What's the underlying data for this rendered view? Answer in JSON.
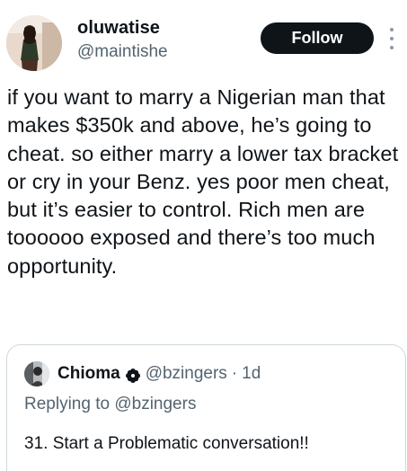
{
  "tweet": {
    "display_name": "oluwatise",
    "handle": "@maintishe",
    "follow_label": "Follow",
    "text": "if you want to marry a Nigerian man that makes $350k and above, he’s going to cheat. so either marry a lower tax bracket or cry in your Benz. yes poor men cheat, but it’s easier to control. Rich men are toooooo exposed and there’s too much opportunity."
  },
  "quote": {
    "display_name": "Chioma",
    "badge_icon": "verified-flower-badge-icon",
    "handle": "@bzingers",
    "separator": "·",
    "time": "1d",
    "replying_prefix": "Replying to",
    "replying_to": "@bzingers",
    "text": "31. Start a Problematic conversation!!"
  },
  "icons": {
    "more": "more-vertical-icon"
  },
  "colors": {
    "text": "#0f1419",
    "secondary": "#536471",
    "follow_bg": "#0f1419",
    "border": "#cfd9de"
  }
}
